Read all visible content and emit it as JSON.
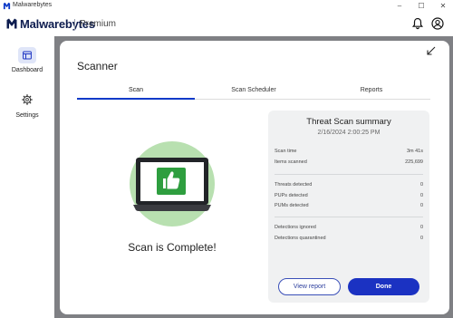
{
  "window": {
    "title": "Malwarebytes",
    "controls": [
      "–",
      "☐",
      "✕"
    ]
  },
  "header": {
    "brand": "Malwarebytes",
    "tier": "Premium",
    "icons": [
      "bell-icon",
      "account-icon"
    ]
  },
  "sidebar": {
    "items": [
      {
        "label": "Dashboard",
        "icon": "dashboard-icon",
        "active": true
      },
      {
        "label": "Settings",
        "icon": "gear-icon",
        "active": false
      }
    ]
  },
  "main": {
    "title": "Scanner",
    "tabs": [
      {
        "label": "Scan",
        "active": true
      },
      {
        "label": "Scan Scheduler",
        "active": false
      },
      {
        "label": "Reports",
        "active": false
      }
    ],
    "status_text": "Scan is Complete!",
    "status_icon": "laptop-thumbs-up-icon"
  },
  "summary": {
    "title": "Threat Scan summary",
    "date": "2/16/2024 2:00:25 PM",
    "groups": [
      [
        {
          "label": "Scan time",
          "value": "3m 41s"
        },
        {
          "label": "Items scanned",
          "value": "225,699"
        }
      ],
      [
        {
          "label": "Threats detected",
          "value": "0"
        },
        {
          "label": "PUPs detected",
          "value": "0"
        },
        {
          "label": "PUMs detected",
          "value": "0"
        }
      ],
      [
        {
          "label": "Detections ignored",
          "value": "0"
        },
        {
          "label": "Detections quarantined",
          "value": "0"
        }
      ]
    ],
    "view_report_label": "View report",
    "done_label": "Done"
  },
  "colors": {
    "brand_navy": "#0d1c4f",
    "accent_blue": "#1b32c2",
    "success_green": "#b8e0b0",
    "thumb_green": "#2e9e3f",
    "backdrop_gray": "#7f8084"
  }
}
